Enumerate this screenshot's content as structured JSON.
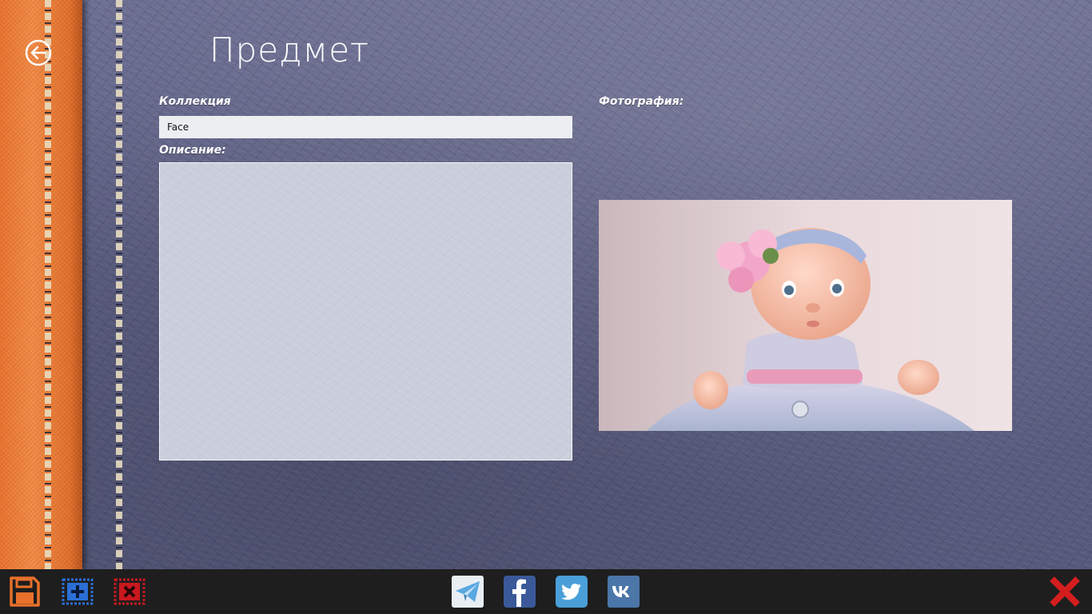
{
  "page": {
    "title": "Предмет"
  },
  "form": {
    "collection_label": "Коллекция",
    "collection_value": "Face",
    "description_label": "Описание:",
    "description_value": "",
    "photo_label": "Фотография:"
  },
  "appbar": {
    "left_buttons": [
      "save-icon",
      "add-item-icon",
      "delete-item-icon"
    ],
    "share_buttons": [
      "telegram-icon",
      "facebook-icon",
      "twitter-icon",
      "vk-icon"
    ],
    "right_buttons": [
      "close-icon"
    ]
  },
  "colors": {
    "accent_orange": "#f08a45",
    "save": "#e8702a",
    "add": "#2b6fd6",
    "delete": "#c8181e",
    "close": "#d41e1e",
    "facebook": "#3b5998",
    "twitter": "#4a9fd8",
    "vk": "#4a76a8",
    "telegram": "#5aa8e0"
  }
}
